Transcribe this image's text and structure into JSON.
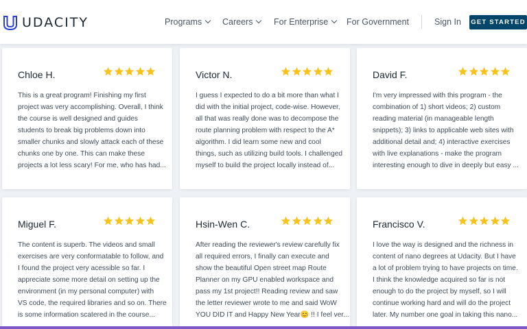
{
  "nav": {
    "brand": "UDACITY",
    "links": [
      "Programs",
      "Careers",
      "For Enterprise",
      "For Government"
    ],
    "sign_in": "Sign In",
    "cta": "GET STARTED"
  },
  "reviews": [
    {
      "name": "Chloe H.",
      "rating": 5,
      "lines": [
        "This is a great program! Finishing my first",
        "project was very accomplishing. Overall, I think",
        "the course is well designed and guides",
        "students to break big problems down into",
        "smaller chunks and slowly attack each of these",
        "chunks one by one. This can make these",
        "projects a lot less scary! For me, who has had..."
      ]
    },
    {
      "name": "Victor N.",
      "rating": 5,
      "lines": [
        "I guess I expected to do a bit more than what I",
        "did with the initial project, code-wise. However,",
        "all that was really done was to decompose the",
        "route planning problem with respect to the A*",
        "algorithm. I did learn some new and cool",
        "things, such as utilizing build tools. I challenged",
        "myself to build the project locally instead of..."
      ]
    },
    {
      "name": "David F.",
      "rating": 5,
      "lines": [
        "I'm very impressed with this program - the",
        "combination of 1) short videos; 2) custom",
        "reading material (in manageable length",
        "snippets); 3) links to applicable web sites with",
        "additional detail and; 4) interactive exercises",
        "with live explanations - make the program",
        "interesting enough to dive in deeply but easy ..."
      ]
    },
    {
      "name": "Miguel F.",
      "rating": 5,
      "lines": [
        "The content is superb. The videos and small",
        "exercises are very conformatable to follow, and",
        "I found the project very acessible so far. I",
        "appreciate some more detail on setting up the",
        "environment (in my personal computer) with",
        "VS code, the required libraries and so on. There",
        "is some information scatered in the course..."
      ]
    },
    {
      "name": "Hsin-Wen C.",
      "rating": 5,
      "lines": [
        "After reading the reviewer's review carefully fix",
        "all required errors, I finally can execute and",
        "show the beautiful Open street map Route",
        "Planner on my GPU enabled workspace and",
        "pass my 1st project!! Reading review and saw",
        "the letter reviewer wrote to me and said WoW",
        "YOU DID IT and Happy New Year😊 !! I feel ver..."
      ]
    },
    {
      "name": "Francisco V.",
      "rating": 5,
      "lines": [
        "I love the way is designed and the richness in",
        "content of nano degrees at Udacity. But I have",
        "a lot of problem trying to have projects on time.",
        "I think the knowledge acquired so far is not",
        "enough to do the project by myself, so I will",
        "continue working hard and will do the project",
        "later. My number one goal in taking this nano..."
      ]
    }
  ],
  "colors": {
    "brand": "#02456b",
    "logo": "#2a3fd1",
    "star": "#f6c21b",
    "accent_bar": "#7c57c7"
  }
}
